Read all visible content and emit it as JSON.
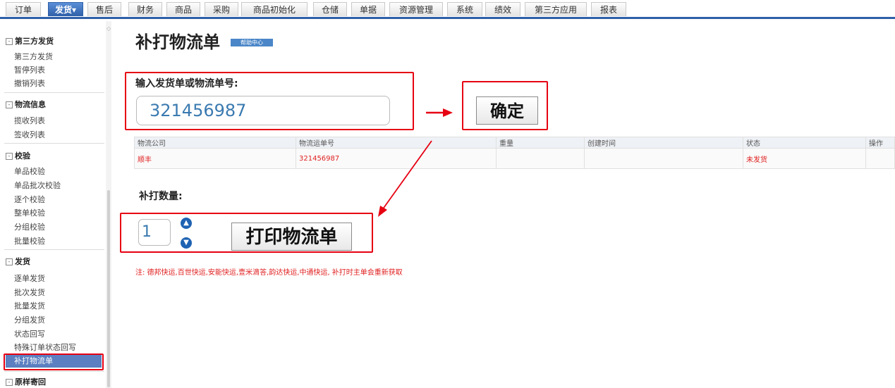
{
  "nav": {
    "tabs": [
      "订单",
      "发货",
      "售后",
      "财务",
      "商品",
      "采购",
      "商品初始化",
      "仓储",
      "单据",
      "资源管理",
      "系统",
      "绩效",
      "第三方应用",
      "报表"
    ],
    "active_suffix": "▾"
  },
  "sidebar": {
    "sections": [
      {
        "label": "第三方发货",
        "items": [
          "第三方发货",
          "暂停列表",
          "撤销列表"
        ]
      },
      {
        "label": "物流信息",
        "items": [
          "揽收列表",
          "签收列表"
        ]
      },
      {
        "label": "校验",
        "items": [
          "单品校验",
          "单品批次校验",
          "逐个校验",
          "整单校验",
          "分组校验",
          "批量校验"
        ]
      },
      {
        "label": "发货",
        "items": [
          "逐单发货",
          "批次发货",
          "批量发货",
          "分组发货",
          "状态回写",
          "特殊订单状态回写",
          "补打物流单"
        ]
      },
      {
        "label": "原样寄回",
        "items": []
      }
    ]
  },
  "main": {
    "title": "补打物流单",
    "help_label": "帮助中心",
    "input_label": "输入发货单或物流单号:",
    "input_value": "321456987",
    "confirm_label": "确定",
    "table": {
      "headers": [
        "物流公司",
        "物流运单号",
        "重量",
        "创建时间",
        "状态",
        "操作"
      ],
      "rows": [
        [
          "顺丰",
          "321456987",
          "",
          "",
          "未发货",
          ""
        ]
      ]
    },
    "qty_label": "补打数量:",
    "qty_value": "1",
    "print_label": "打印物流单",
    "note": "注: 德邦快运,百世快运,安能快运,壹米滴答,韵达快运,中通快运, 补打时主单会重新获取"
  },
  "colors": {
    "accent": "#2f5fa8",
    "highlight": "#e60012",
    "selected": "#5b7fc0"
  }
}
